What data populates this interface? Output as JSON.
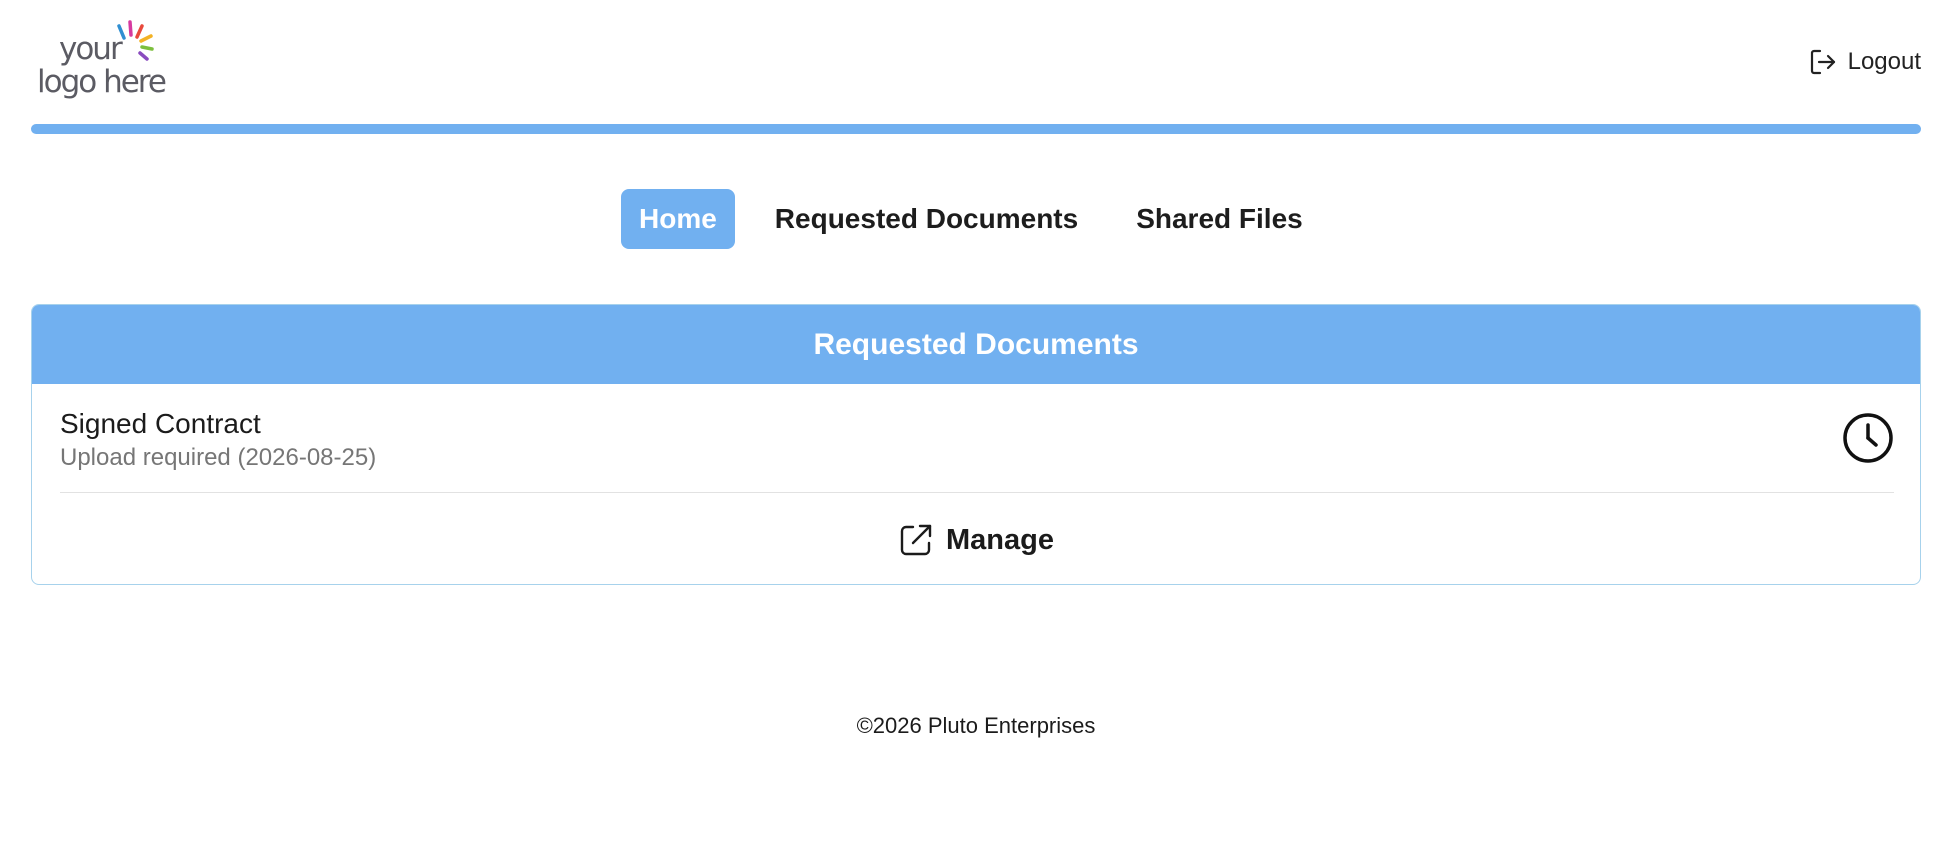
{
  "logo": {
    "line1": "your",
    "line2": "logo here"
  },
  "header": {
    "logout_label": "Logout",
    "logout_icon": "logout-icon"
  },
  "colors": {
    "accent": "#71b0f0",
    "card_border": "#a7d2ec",
    "text": "#1b1b1b",
    "muted_text": "#767676"
  },
  "nav": {
    "items": [
      {
        "label": "Home",
        "active": true
      },
      {
        "label": "Requested Documents",
        "active": false
      },
      {
        "label": "Shared Files",
        "active": false
      }
    ]
  },
  "requested_documents": {
    "title": "Requested Documents",
    "items": [
      {
        "name": "Signed Contract",
        "status": "Upload required (2026-08-25)",
        "status_icon": "clock-icon"
      }
    ],
    "manage_label": "Manage",
    "manage_icon": "external-link-icon"
  },
  "footer": {
    "copyright": "©2026 Pluto Enterprises"
  }
}
